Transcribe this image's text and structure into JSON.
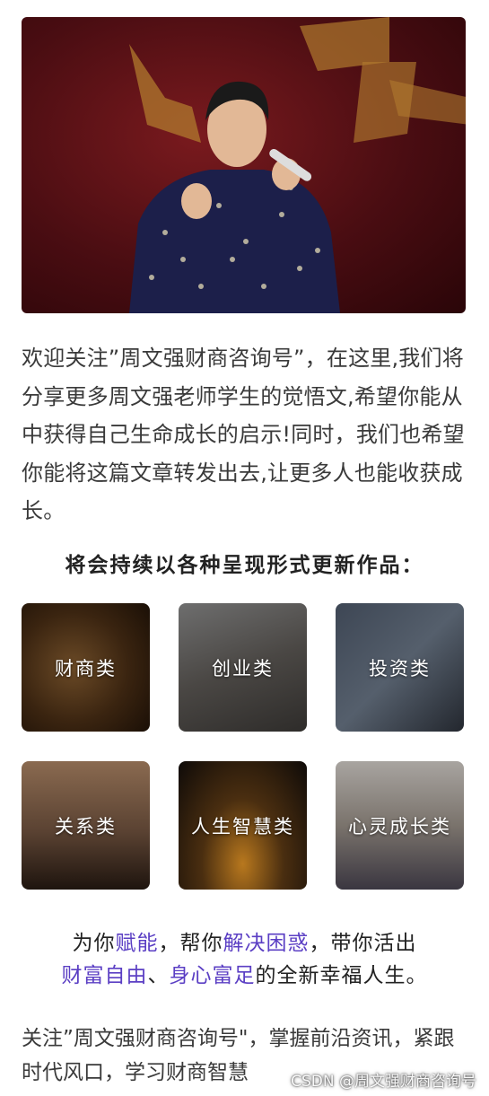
{
  "intro": "欢迎关注”周文强财商咨询号”，在这里,我们将分享更多周文强老师学生的觉悟文,希望你能从中获得自己生命成长的启示!同时，我们也希望你能将这篇文章转发出去,让更多人也能收获成长。",
  "section_title": "将会持续以各种呈现形式更新作品：",
  "categories": [
    {
      "label": "财商类"
    },
    {
      "label": "创业类"
    },
    {
      "label": "投资类"
    },
    {
      "label": "关系类"
    },
    {
      "label": "人生智慧类"
    },
    {
      "label": "心灵成长类"
    }
  ],
  "slogan": {
    "p1": "为你",
    "h1": "赋能",
    "p2": "，帮你",
    "h2": "解决困惑",
    "p3": "，带你活出",
    "h3": "财富自由",
    "p4": "、",
    "h4": "身心富足",
    "p5": "的全新幸福人生。"
  },
  "footer": "关注”周文强财商咨询号\"，掌握前沿资讯，紧跟时代风口，学习财商智慧",
  "watermark": "CSDN @周文强财商咨询号",
  "colors": {
    "highlight": "#5b3fc4",
    "hero_bg": "#4a0d12"
  }
}
